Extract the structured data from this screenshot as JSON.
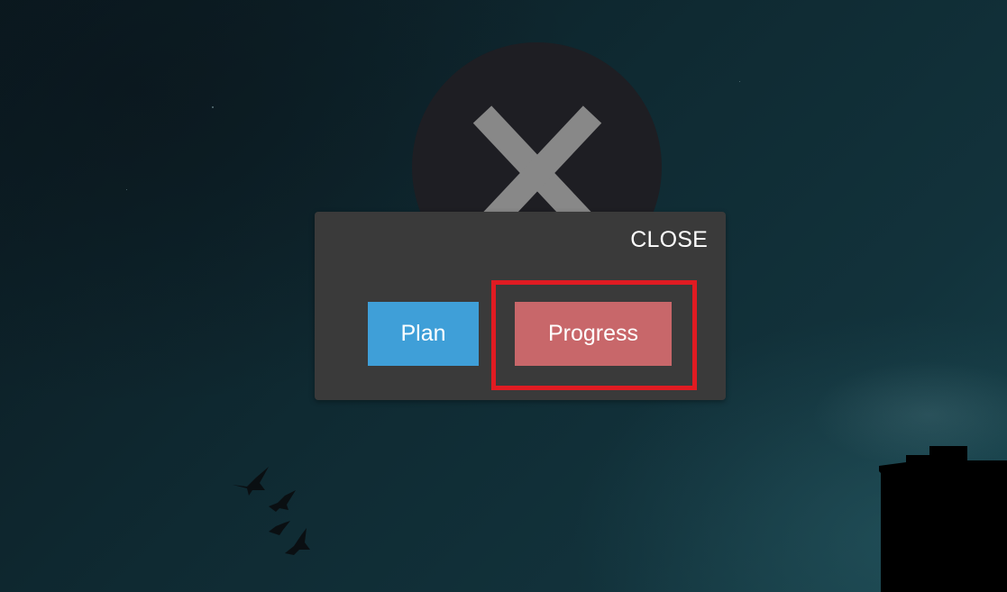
{
  "background": {
    "description_icon": "night-sky-background",
    "colors": {
      "sky_dark": "#0b1a21",
      "sky_light": "#17414a"
    }
  },
  "close_circle": {
    "icon": "close-x-icon",
    "background_color": "#1e1e23",
    "icon_color": "#888888"
  },
  "dialog": {
    "close_label": "CLOSE",
    "buttons": {
      "plan_label": "Plan",
      "progress_label": "Progress"
    },
    "colors": {
      "background": "#3a3a3a",
      "plan": "#3f9fd8",
      "progress": "#c8676a"
    }
  },
  "annotation": {
    "highlight_color": "#e01b22",
    "target": "progress-button"
  }
}
